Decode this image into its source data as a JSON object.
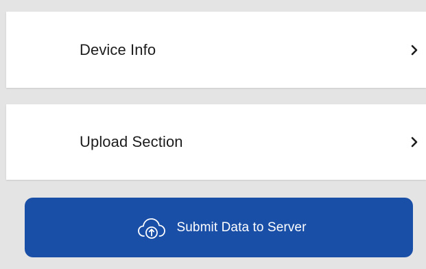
{
  "menu": {
    "items": [
      {
        "label": "Device Info",
        "icon": "chevron-right-icon"
      },
      {
        "label": "Upload Section",
        "icon": "chevron-right-icon"
      }
    ]
  },
  "submit": {
    "label": "Submit Data to Server",
    "icon": "cloud-upload-icon"
  },
  "colors": {
    "background": "#e4e4e4",
    "card": "#ffffff",
    "primary": "#1a4fa8",
    "text": "#1c1c1c",
    "button_text": "#ffffff"
  }
}
